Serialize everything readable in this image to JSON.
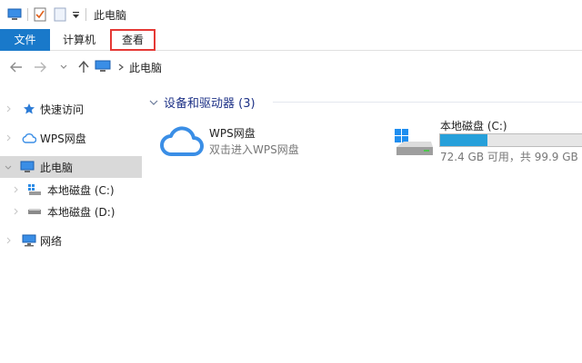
{
  "window": {
    "title": "此电脑"
  },
  "ribbon": {
    "tabs": [
      {
        "label": "文件"
      },
      {
        "label": "计算机"
      },
      {
        "label": "查看"
      }
    ]
  },
  "address": {
    "path": "此电脑"
  },
  "sidebar": {
    "items": [
      {
        "label": "快速访问",
        "icon": "star-icon"
      },
      {
        "label": "WPS网盘",
        "icon": "cloud-icon"
      },
      {
        "label": "此电脑",
        "icon": "computer-icon",
        "selected": true
      },
      {
        "label": "本地磁盘 (C:)",
        "icon": "windows-drive-icon"
      },
      {
        "label": "本地磁盘 (D:)",
        "icon": "drive-icon"
      },
      {
        "label": "网络",
        "icon": "network-icon"
      }
    ]
  },
  "content": {
    "group_title": "设备和驱动器 (3)",
    "wps": {
      "title": "WPS网盘",
      "subtitle": "双击进入WPS网盘"
    },
    "drive_c": {
      "title": "本地磁盘 (C:)",
      "usage_text": "72.4 GB 可用，共 99.9 GB",
      "used_fraction": 0.33
    }
  },
  "colors": {
    "accent": "#1979ca",
    "highlight_border": "#e53935",
    "drive_bar": "#26a0da",
    "group_title": "#1e3287"
  }
}
